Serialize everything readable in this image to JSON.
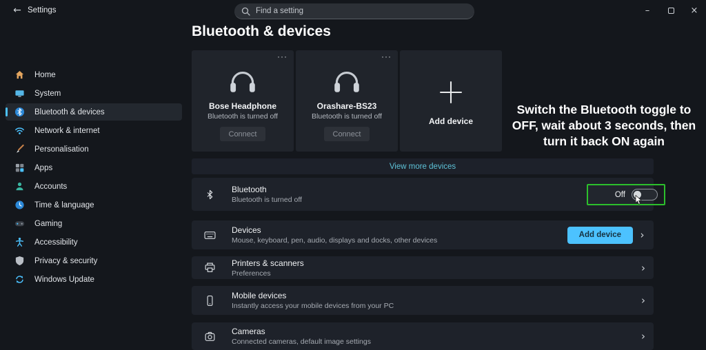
{
  "titlebar": {
    "back_glyph": "←",
    "app_title": "Settings",
    "search_placeholder": "Find a setting",
    "minimize_glyph": "–",
    "close_glyph": "×"
  },
  "sidebar": {
    "items": [
      {
        "label": "Home"
      },
      {
        "label": "System"
      },
      {
        "label": "Bluetooth & devices",
        "selected": true
      },
      {
        "label": "Network & internet"
      },
      {
        "label": "Personalisation"
      },
      {
        "label": "Apps"
      },
      {
        "label": "Accounts"
      },
      {
        "label": "Time & language"
      },
      {
        "label": "Gaming"
      },
      {
        "label": "Accessibility"
      },
      {
        "label": "Privacy & security"
      },
      {
        "label": "Windows Update"
      }
    ]
  },
  "main": {
    "page_title": "Bluetooth & devices",
    "device_cards": [
      {
        "name": "Bose Headphone",
        "status": "Bluetooth is turned off",
        "action": "Connect",
        "menu": "···"
      },
      {
        "name": "Orashare-BS23",
        "status": "Bluetooth is turned off",
        "action": "Connect",
        "menu": "···"
      }
    ],
    "add_device_card": {
      "label": "Add device"
    },
    "view_more_link": "View more devices",
    "annotation": "Switch the Bluetooth toggle to OFF, wait about 3 seconds, then turn it back ON again",
    "bluetooth_row": {
      "title": "Bluetooth",
      "subtitle": "Bluetooth is turned off",
      "toggle_label": "Off",
      "toggle_state": "off"
    },
    "rows": [
      {
        "title": "Devices",
        "subtitle": "Mouse, keyboard, pen, audio, displays and docks, other devices",
        "button": "Add device",
        "chevron": "›"
      },
      {
        "title": "Printers & scanners",
        "subtitle": "Preferences",
        "chevron": "›"
      },
      {
        "title": "Mobile devices",
        "subtitle": "Instantly access your mobile devices from your PC",
        "chevron": "›"
      },
      {
        "title": "Cameras",
        "subtitle": "Connected cameras, default image settings",
        "chevron": "›"
      }
    ]
  },
  "colors": {
    "accent_blue": "#4cc2ff",
    "link_cyan": "#5ec3d8",
    "highlight_green": "#2cc02c",
    "row_background": "#1e222a"
  }
}
